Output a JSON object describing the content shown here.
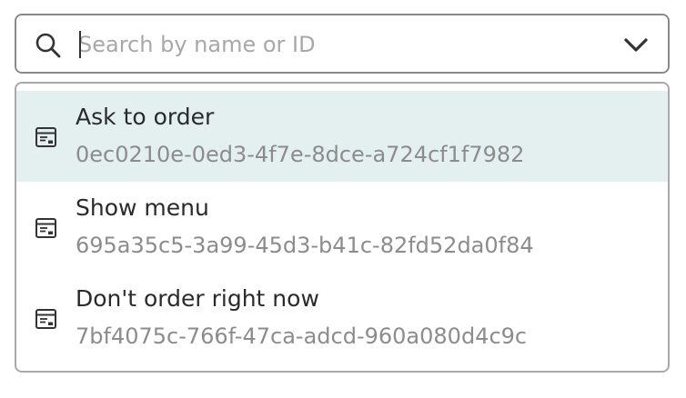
{
  "search": {
    "placeholder": "Search by name or ID",
    "value": ""
  },
  "icons": {
    "search": "search-icon",
    "toggle": "chevron-down-icon",
    "option": "dialog-window-icon"
  },
  "options": [
    {
      "label": "Ask to order",
      "id": "0ec0210e-0ed3-4f7e-8dce-a724cf1f7982",
      "highlighted": true
    },
    {
      "label": "Show menu",
      "id": "695a35c5-3a99-45d3-b41c-82fd52da0f84",
      "highlighted": false
    },
    {
      "label": "Don't order right now",
      "id": "7bf4075c-766f-47ca-adcd-960a080d4c9c",
      "highlighted": false
    }
  ],
  "colors": {
    "highlight": "#e4f0ef",
    "border": "#8a8a8a",
    "primary_text": "#2a2a2a",
    "secondary_text": "#8c8c8c",
    "placeholder": "#a8a8a8"
  }
}
